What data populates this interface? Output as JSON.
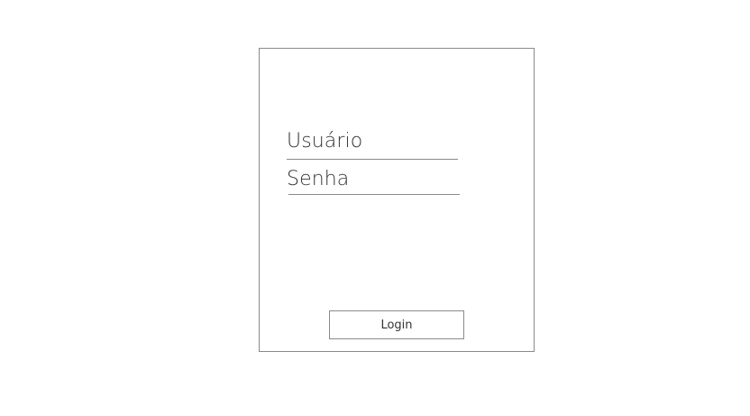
{
  "login_form": {
    "username_label": "Usuário",
    "password_label": "Senha",
    "login_button_label": "Login"
  }
}
